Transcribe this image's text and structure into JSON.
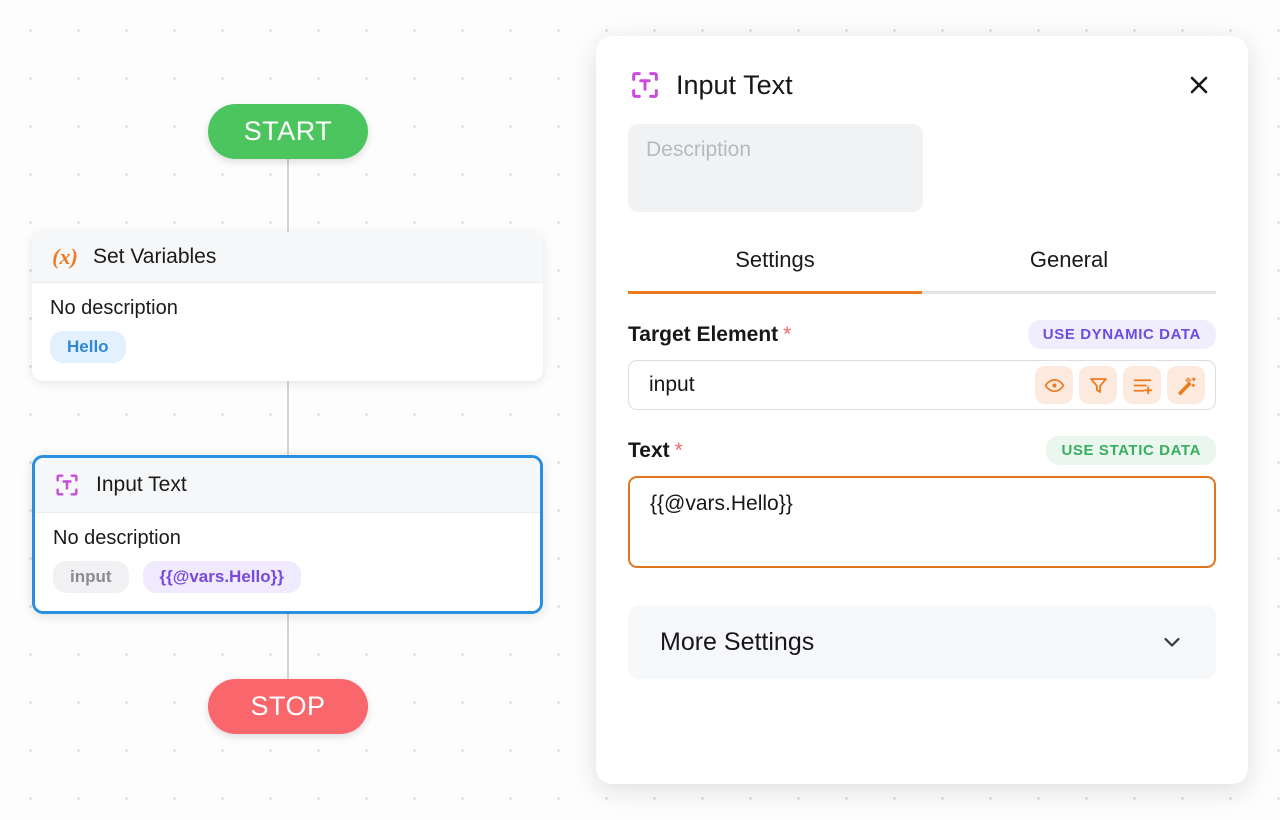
{
  "canvas": {
    "start_label": "START",
    "stop_label": "STOP",
    "nodes": [
      {
        "icon": "variable-x-icon",
        "title": "Set Variables",
        "description": "No description",
        "tags": [
          {
            "label": "Hello",
            "style": "blue"
          }
        ]
      },
      {
        "icon": "input-text-icon",
        "title": "Input Text",
        "description": "No description",
        "tags": [
          {
            "label": "input",
            "style": "gray"
          },
          {
            "label": "{{@vars.Hello}}",
            "style": "purple"
          }
        ]
      }
    ]
  },
  "panel": {
    "icon": "input-text-icon",
    "title": "Input Text",
    "close_icon": "close-icon",
    "description_placeholder": "Description",
    "description_value": "",
    "tabs": [
      {
        "label": "Settings",
        "active": true
      },
      {
        "label": "General",
        "active": false
      }
    ],
    "target_element": {
      "label": "Target Element",
      "required_marker": "*",
      "badge": "USE DYNAMIC DATA",
      "value": "input",
      "placeholder": "",
      "actions": [
        {
          "icon": "eye-icon"
        },
        {
          "icon": "filter-icon"
        },
        {
          "icon": "list-plus-icon"
        },
        {
          "icon": "magic-wand-icon"
        }
      ]
    },
    "text_field": {
      "label": "Text",
      "required_marker": "*",
      "badge": "USE STATIC DATA",
      "value": "{{@vars.Hello}}",
      "placeholder": ""
    },
    "more_settings": {
      "label": "More Settings",
      "chevron_icon": "chevron-down-icon"
    }
  },
  "colors": {
    "accent_orange": "#EE7A1E",
    "start_green": "#4CC55E",
    "stop_red": "#F9676C",
    "selection_blue": "#2B8FE0",
    "purple": "#7849E0",
    "badge_green": "#39AE5E"
  }
}
